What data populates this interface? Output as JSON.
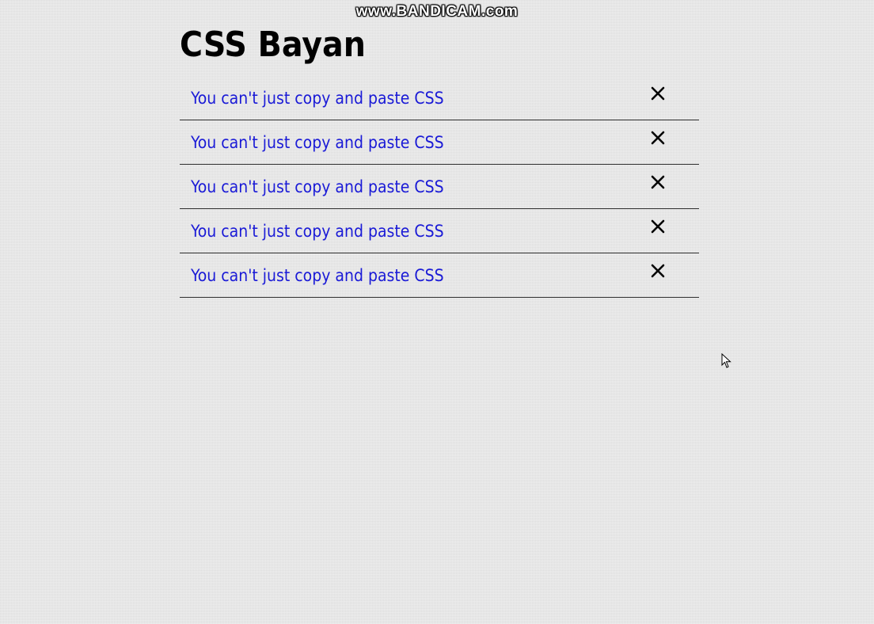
{
  "watermark": "www.BANDICAM.com",
  "page": {
    "title": "CSS Bayan"
  },
  "accordion": {
    "items": [
      {
        "label": "You can't just copy and paste CSS",
        "close_icon": "close-icon"
      },
      {
        "label": "You can't just copy and paste CSS",
        "close_icon": "close-icon"
      },
      {
        "label": "You can't just copy and paste CSS",
        "close_icon": "close-icon"
      },
      {
        "label": "You can't just copy and paste CSS",
        "close_icon": "close-icon"
      },
      {
        "label": "You can't just copy and paste CSS",
        "close_icon": "close-icon"
      }
    ]
  },
  "colors": {
    "background": "#e6e6e6",
    "link": "#1a1ad6",
    "text": "#000000",
    "divider": "#333333"
  },
  "cursor": "mouse-pointer-icon"
}
